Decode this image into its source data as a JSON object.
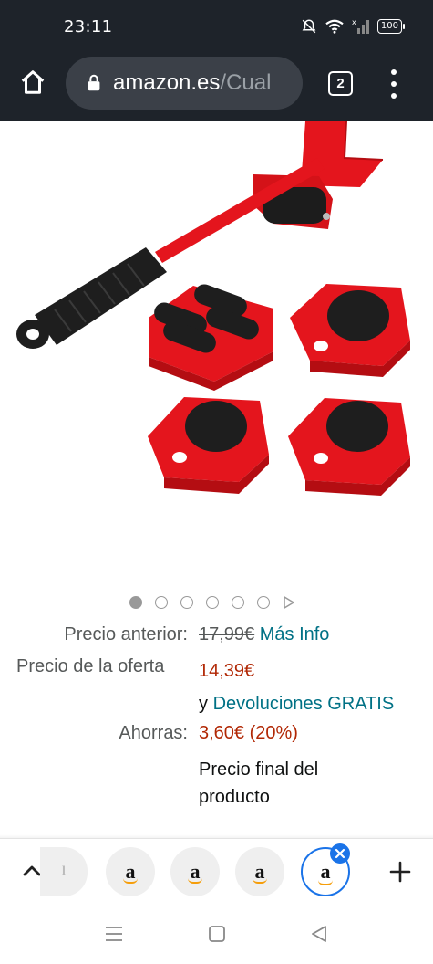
{
  "status_bar": {
    "time": "23:11",
    "battery": "100",
    "icons": [
      "bell-off-icon",
      "wifi-icon",
      "signal-icon",
      "battery-icon"
    ]
  },
  "browser": {
    "url_domain": "amazon.es",
    "url_path": "/Cual",
    "tab_count": "2",
    "icons": [
      "home-icon",
      "lock-icon",
      "more-vert-icon"
    ]
  },
  "product": {
    "image_alt_icons": [
      "furniture-lifter-tool",
      "mover-sliders"
    ],
    "carousel": {
      "total": 6,
      "active_index": 0
    }
  },
  "pricing": {
    "previous_label": "Precio anterior:",
    "previous_value": "17,99€",
    "more_info": "Más Info",
    "offer_label": "Precio de la oferta",
    "offer_value": "14,39€",
    "returns_prefix": "y",
    "returns_link": "Devoluciones GRATIS",
    "savings_label": "Ahorras:",
    "savings_value": "3,60€ (20%)",
    "final_note_line1": "Precio final del",
    "final_note_line2": "producto"
  },
  "tab_strip": {
    "tab_letter": "a",
    "tabs": [
      "partial-tab",
      "amazon-tab",
      "amazon-tab",
      "amazon-tab",
      "amazon-tab-active"
    ],
    "accent": "#1a73e8"
  },
  "colors": {
    "chrome_bg": "#1e232a",
    "price_red": "#b12704",
    "link": "#007185",
    "product_red": "#e4151d"
  }
}
